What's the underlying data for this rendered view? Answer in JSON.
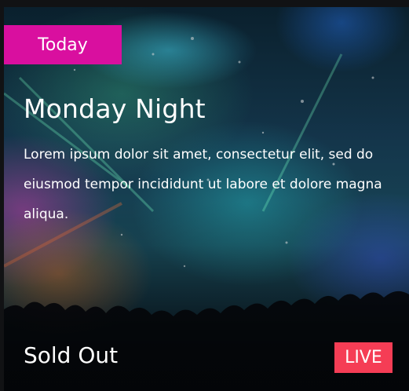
{
  "event": {
    "tag_label": "Today",
    "title": "Monday Night",
    "description": "Lorem ipsum dolor sit amet, consectetur elit, sed do eiusmod tempor incididunt ut labore et dolore magna aliqua.",
    "status": "Sold Out",
    "live_badge": "LIVE"
  },
  "colors": {
    "tag_bg": "#d90f9f",
    "live_bg": "#f53d55",
    "text": "#ffffff"
  }
}
